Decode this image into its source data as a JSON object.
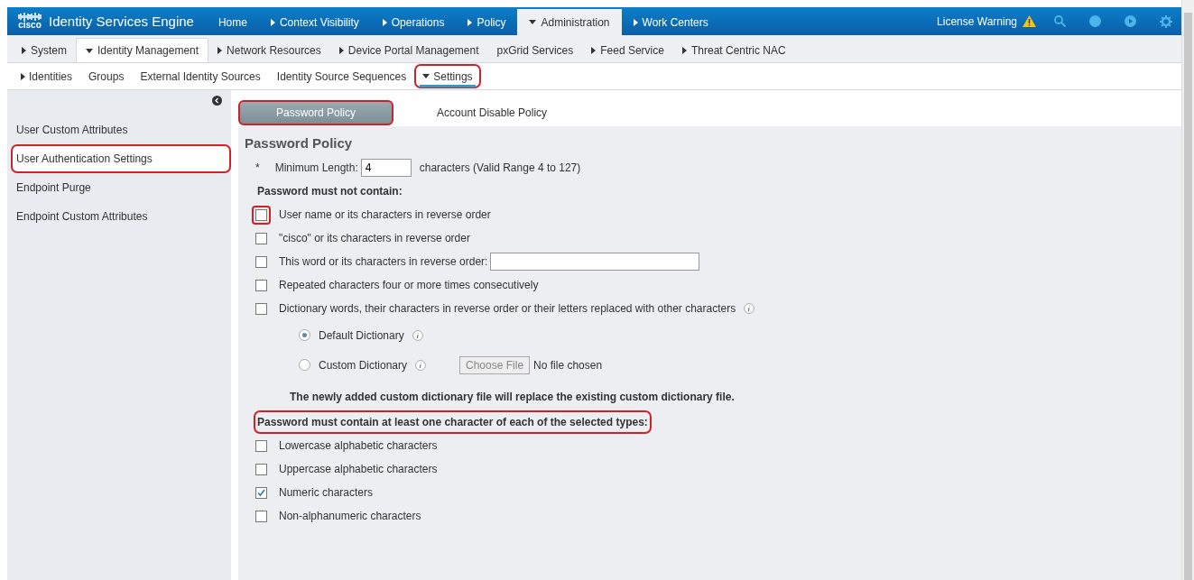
{
  "header": {
    "logo_text": "cisco",
    "product": "Identity Services Engine",
    "license_warning": "License Warning",
    "nav": [
      {
        "label": "Home",
        "kind": "plain",
        "selected": false
      },
      {
        "label": "Context Visibility",
        "kind": "collapsed",
        "selected": false
      },
      {
        "label": "Operations",
        "kind": "collapsed",
        "selected": false
      },
      {
        "label": "Policy",
        "kind": "collapsed",
        "selected": false
      },
      {
        "label": "Administration",
        "kind": "expanded",
        "selected": true
      },
      {
        "label": "Work Centers",
        "kind": "collapsed",
        "selected": false
      }
    ]
  },
  "subnav": [
    {
      "label": "System",
      "kind": "collapsed",
      "selected": false
    },
    {
      "label": "Identity Management",
      "kind": "expanded",
      "selected": true
    },
    {
      "label": "Network Resources",
      "kind": "collapsed",
      "selected": false
    },
    {
      "label": "Device Portal Management",
      "kind": "collapsed",
      "selected": false
    },
    {
      "label": "pxGrid Services",
      "kind": "plain",
      "selected": false
    },
    {
      "label": "Feed Service",
      "kind": "collapsed",
      "selected": false
    },
    {
      "label": "Threat Centric NAC",
      "kind": "collapsed",
      "selected": false
    }
  ],
  "subnav2": [
    {
      "label": "Identities",
      "kind": "collapsed",
      "selected": false,
      "highlighted": false
    },
    {
      "label": "Groups",
      "kind": "plain",
      "selected": false,
      "highlighted": false
    },
    {
      "label": "External Identity Sources",
      "kind": "plain",
      "selected": false,
      "highlighted": false
    },
    {
      "label": "Identity Source Sequences",
      "kind": "plain",
      "selected": false,
      "highlighted": false
    },
    {
      "label": "Settings",
      "kind": "expanded",
      "selected": true,
      "highlighted": true
    }
  ],
  "sidebar": {
    "items": [
      {
        "label": "User Custom Attributes",
        "selected": false,
        "highlighted": false
      },
      {
        "label": "User Authentication Settings",
        "selected": true,
        "highlighted": true
      },
      {
        "label": "Endpoint Purge",
        "selected": false,
        "highlighted": false
      },
      {
        "label": "Endpoint Custom Attributes",
        "selected": false,
        "highlighted": false
      }
    ]
  },
  "tabs": [
    {
      "label": "Password Policy",
      "selected": true,
      "highlighted": true
    },
    {
      "label": "Account Disable Policy",
      "selected": false,
      "highlighted": false
    }
  ],
  "policy": {
    "title": "Password Policy",
    "min_length": {
      "required_mark": "*",
      "label": "Minimum Length:",
      "value": "4",
      "hint": "characters (Valid Range 4 to 127)"
    },
    "must_not_contain": {
      "heading": "Password must not contain:",
      "highlighted": false,
      "items": [
        {
          "kind": "checkbox",
          "label": "User name or its characters in reverse order",
          "checked": false,
          "highlighted": true
        },
        {
          "kind": "checkbox",
          "label": "\"cisco\" or its characters in reverse order",
          "checked": false,
          "highlighted": false
        },
        {
          "kind": "checkbox-field",
          "label": "This word or its characters in reverse order:",
          "checked": false,
          "highlighted": false
        },
        {
          "kind": "checkbox",
          "label": "Repeated characters four or more times consecutively",
          "checked": false,
          "highlighted": false
        },
        {
          "kind": "checkbox-info",
          "label": "Dictionary words, their characters in reverse order or their letters replaced with other characters",
          "checked": false,
          "highlighted": false
        }
      ]
    },
    "dictionary": {
      "options": [
        {
          "label": "Default Dictionary",
          "selected": true
        },
        {
          "label": "Custom Dictionary",
          "selected": false
        }
      ],
      "choose_file": "Choose File",
      "file_status": "No file chosen",
      "note": "The newly added custom dictionary file will replace the existing custom dictionary file."
    },
    "must_contain": {
      "heading": "Password must contain at least one character of each of the selected types:",
      "highlighted": true,
      "items": [
        {
          "kind": "checkbox",
          "label": "Lowercase alphabetic characters",
          "checked": false,
          "highlighted": false
        },
        {
          "kind": "checkbox",
          "label": "Uppercase alphabetic characters",
          "checked": false,
          "highlighted": false
        },
        {
          "kind": "checkbox",
          "label": "Numeric characters",
          "checked": true,
          "highlighted": false
        },
        {
          "kind": "checkbox",
          "label": "Non-alphanumeric characters",
          "checked": false,
          "highlighted": false
        }
      ]
    }
  }
}
